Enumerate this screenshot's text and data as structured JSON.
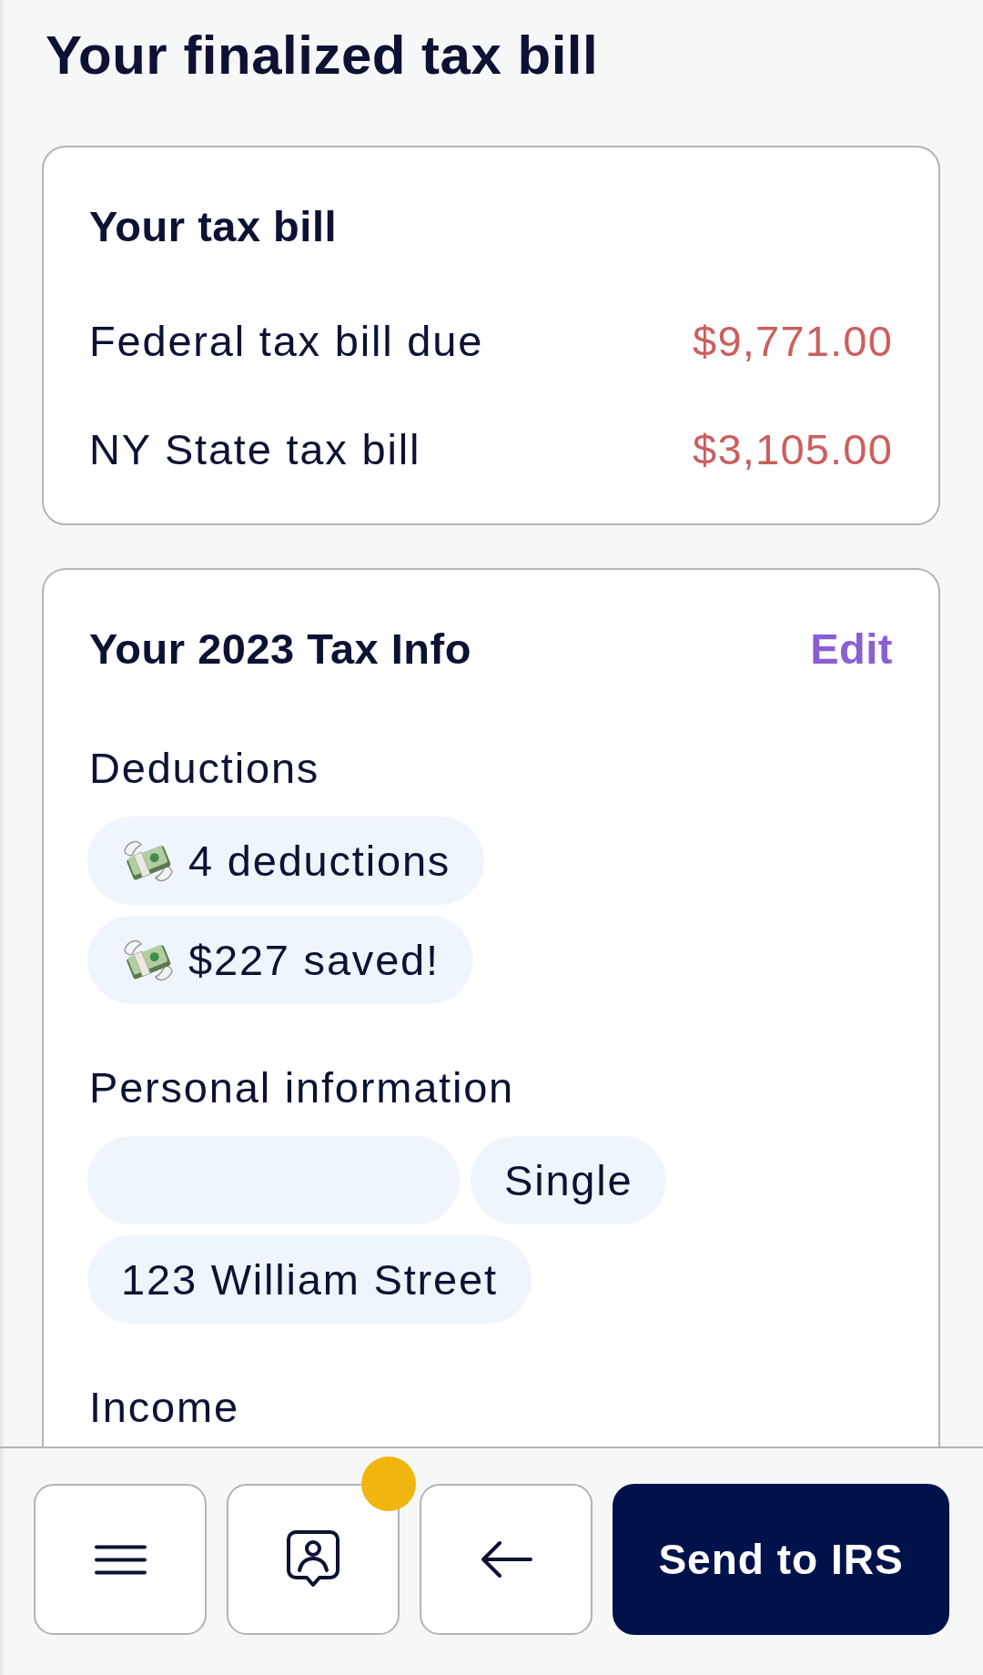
{
  "page": {
    "title": "Your finalized tax bill"
  },
  "tax_bill_card": {
    "title": "Your tax bill",
    "rows": [
      {
        "label": "Federal tax bill due",
        "amount": "$9,771.00"
      },
      {
        "label": "NY State tax bill",
        "amount": "$3,105.00"
      }
    ]
  },
  "tax_info_card": {
    "title": "Your 2023 Tax Info",
    "edit_link": "Edit",
    "sections": [
      {
        "heading": "Deductions",
        "chips": [
          {
            "kind": "money",
            "label": "4 deductions"
          },
          {
            "kind": "money",
            "label": "$227 saved!"
          }
        ]
      },
      {
        "heading": "Personal information",
        "chips": [
          {
            "kind": "blank"
          },
          {
            "kind": "text",
            "label": "Single"
          },
          {
            "kind": "text",
            "label": "123 William Street"
          }
        ]
      },
      {
        "heading": "Income"
      }
    ]
  },
  "bottom_bar": {
    "buttons": [
      {
        "kind": "menu"
      },
      {
        "kind": "support",
        "notification": true
      },
      {
        "kind": "back"
      },
      {
        "kind": "primary",
        "label": "Send to IRS"
      }
    ]
  }
}
